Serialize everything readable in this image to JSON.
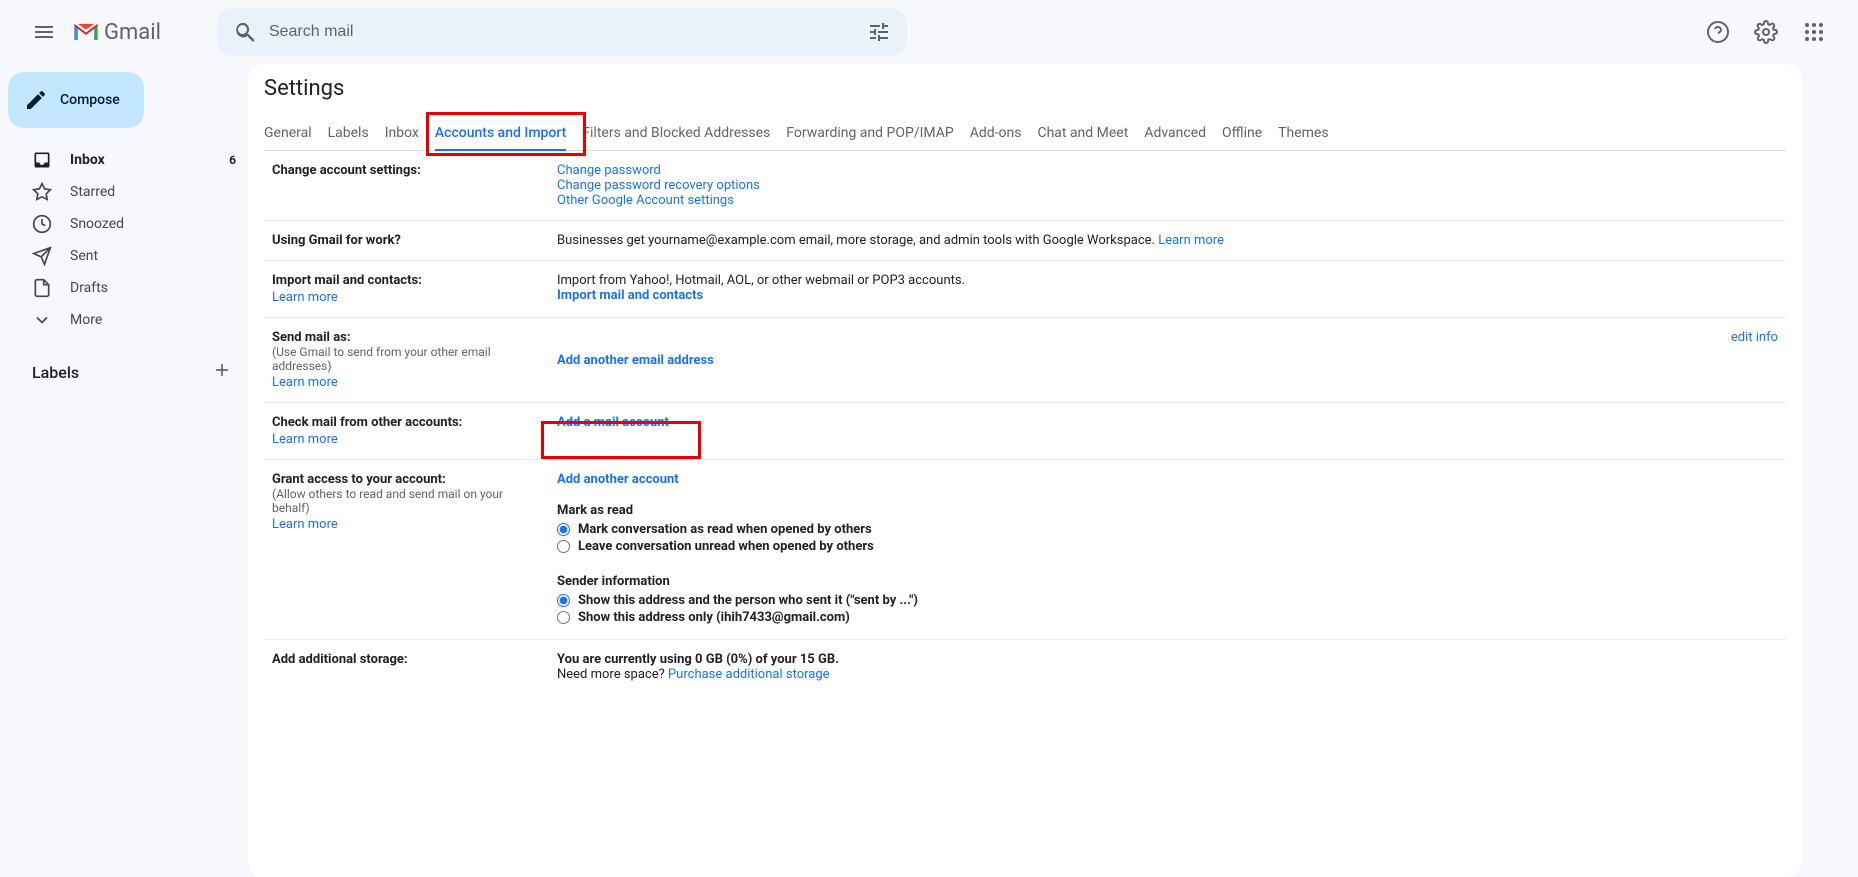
{
  "header": {
    "app_name": "Gmail",
    "search_placeholder": "Search mail"
  },
  "sidebar": {
    "compose": "Compose",
    "items": [
      {
        "label": "Inbox",
        "count": "6"
      },
      {
        "label": "Starred"
      },
      {
        "label": "Snoozed"
      },
      {
        "label": "Sent"
      },
      {
        "label": "Drafts"
      },
      {
        "label": "More"
      }
    ],
    "labels_header": "Labels"
  },
  "settings": {
    "title": "Settings",
    "tabs": [
      "General",
      "Labels",
      "Inbox",
      "Accounts and Import",
      "Filters and Blocked Addresses",
      "Forwarding and POP/IMAP",
      "Add-ons",
      "Chat and Meet",
      "Advanced",
      "Offline",
      "Themes"
    ],
    "rows": {
      "change_account": {
        "label": "Change account settings:",
        "link1": "Change password",
        "link2": "Change password recovery options",
        "link3": "Other Google Account settings"
      },
      "work": {
        "label": "Using Gmail for work?",
        "text": "Businesses get yourname@example.com email, more storage, and admin tools with Google Workspace. ",
        "learn": "Learn more"
      },
      "import": {
        "label": "Import mail and contacts:",
        "learn": "Learn more",
        "text": "Import from Yahoo!, Hotmail, AOL, or other webmail or POP3 accounts.",
        "link": "Import mail and contacts"
      },
      "send_as": {
        "label": "Send mail as:",
        "sub": "(Use Gmail to send from your other email addresses)",
        "learn": "Learn more",
        "link": "Add another email address",
        "edit": "edit info"
      },
      "check_mail": {
        "label": "Check mail from other accounts:",
        "learn": "Learn more",
        "link": "Add a mail account"
      },
      "grant": {
        "label": "Grant access to your account:",
        "sub": "(Allow others to read and send mail on your behalf)",
        "learn": "Learn more",
        "link": "Add another account",
        "mark_label": "Mark as read",
        "radio1": "Mark conversation as read when opened by others",
        "radio2": "Leave conversation unread when opened by others",
        "sender_label": "Sender information",
        "radio3": "Show this address and the person who sent it (\"sent by ...\")",
        "radio4": "Show this address only (ihih7433@gmail.com)"
      },
      "storage": {
        "label": "Add additional storage:",
        "text": "You are currently using 0 GB (0%) of your 15 GB.",
        "text2": "Need more space? ",
        "link": "Purchase additional storage"
      }
    }
  }
}
